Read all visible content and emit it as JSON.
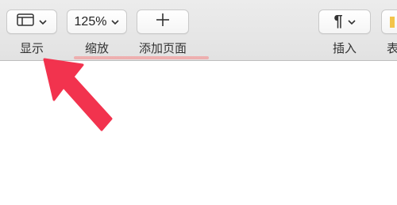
{
  "toolbar": {
    "view_label": "显示",
    "zoom_value": "125%",
    "zoom_label": "缩放",
    "add_page_label": "添加页面",
    "insert_label": "插入",
    "partial_label": "表"
  },
  "colors": {
    "arrow": "#f2334e",
    "highlight": "#f0a3a3",
    "toolbar_bg": "#e6e6e6"
  },
  "icons": [
    "sidebar-view-icon",
    "chevron-down-icon",
    "plus-icon",
    "paragraph-icon",
    "pointer-arrow-icon"
  ]
}
